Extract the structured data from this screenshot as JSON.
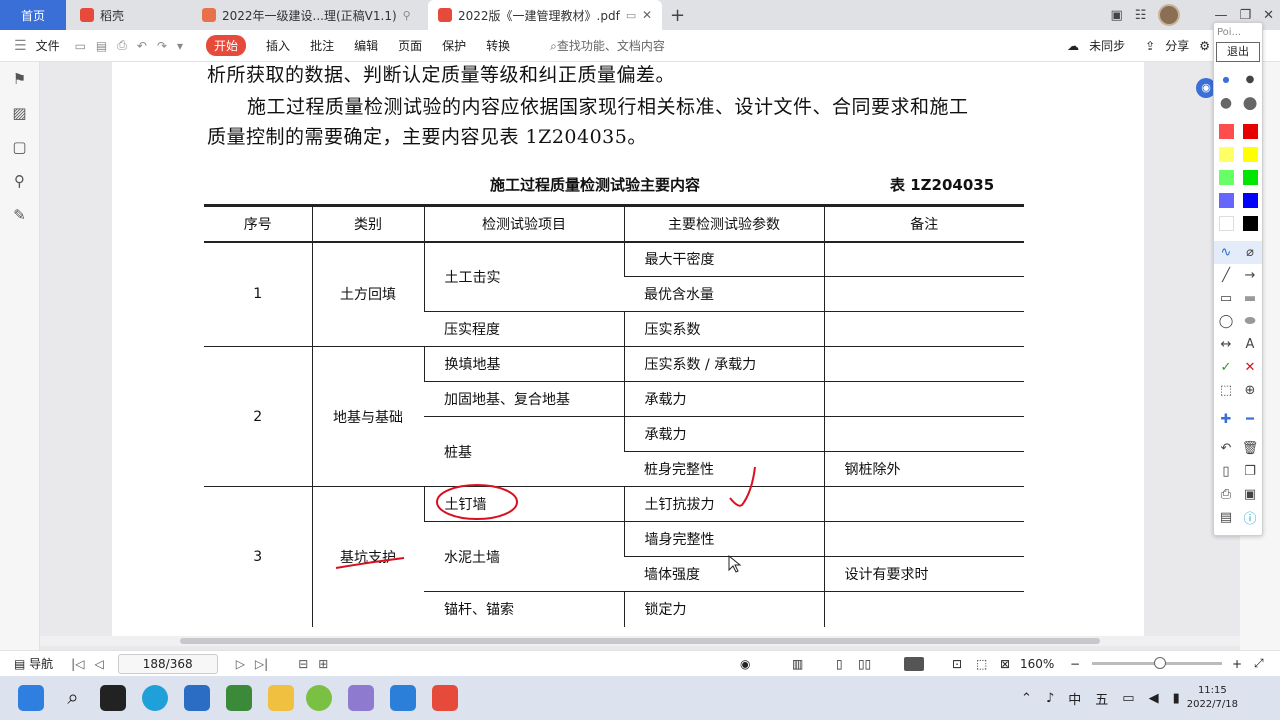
{
  "tabs": [
    {
      "label": "首页"
    },
    {
      "label": "稻壳"
    },
    {
      "label": "2022年一级建设...理(正稿V1.1)"
    },
    {
      "label": "2022版《一建管理教材》.pdf"
    }
  ],
  "menu": {
    "file": "文件",
    "start": "开始",
    "items": [
      "插入",
      "批注",
      "编辑",
      "页面",
      "保护",
      "转换"
    ],
    "search": "查找功能、文档内容",
    "sync": "未同步",
    "share": "分享"
  },
  "document": {
    "para1": "析所获取的数据、判断认定质量等级和纠正质量偏差。",
    "para2": "施工过程质量检测试验的内容应依据国家现行相关标准、设计文件、合同要求和施工",
    "para3": "质量控制的需要确定，主要内容见表 1Z204035。",
    "table_title": "施工过程质量检测试验主要内容",
    "table_no": "表 1Z204035",
    "headers": [
      "序号",
      "类别",
      "检测试验项目",
      "主要检测试验参数",
      "备注"
    ],
    "rows": {
      "r1": {
        "no": "1",
        "cat": "土方回填",
        "item": "土工击实",
        "param1": "最大干密度",
        "param2": "最优含水量"
      },
      "r2": {
        "item": "压实程度",
        "param": "压实系数"
      },
      "r3": {
        "no": "2",
        "cat": "地基与基础",
        "item": "换填地基",
        "param": "压实系数 / 承载力"
      },
      "r4": {
        "item": "加固地基、复合地基",
        "param": "承载力"
      },
      "r5": {
        "item": "桩基",
        "param1": "承载力",
        "param2": "桩身完整性",
        "note2": "钢桩除外"
      },
      "r6": {
        "no": "3",
        "cat": "基坑支护",
        "item": "土钉墙",
        "param": "土钉抗拔力"
      },
      "r7": {
        "item": "水泥土墙",
        "param1": "墙身完整性",
        "param2": "墙体强度",
        "note2": "设计有要求时"
      },
      "r8": {
        "item": "锚杆、锚索",
        "param": "锁定力"
      }
    }
  },
  "status": {
    "nav": "导航",
    "page": "188/368",
    "zoom": "160%"
  },
  "palette": {
    "title": "Poi...",
    "exit": "退出",
    "colors": [
      "#ff4d4d",
      "#e60000",
      "#ffff66",
      "#ffff00",
      "#66ff66",
      "#00e600",
      "#6666ff",
      "#0000ff",
      "#ffffff",
      "#000000"
    ]
  },
  "clock": {
    "time": "11:15",
    "date": "2022/7/18"
  },
  "tray": {
    "ime1": "中",
    "ime2": "五"
  }
}
